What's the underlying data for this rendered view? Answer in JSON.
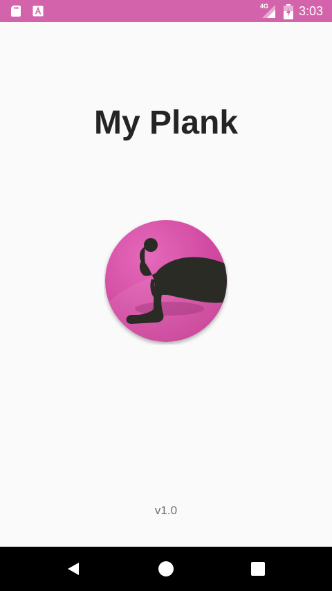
{
  "status_bar": {
    "network_label": "4G",
    "time": "3:03",
    "color": "#d364ab"
  },
  "app": {
    "title": "My Plank",
    "version": "v1.0"
  },
  "logo": {
    "description": "woman-planking-silhouette-icon",
    "color": "#d94aa4"
  },
  "nav_bar": {
    "buttons": [
      "back-icon",
      "home-icon",
      "recents-icon"
    ]
  }
}
